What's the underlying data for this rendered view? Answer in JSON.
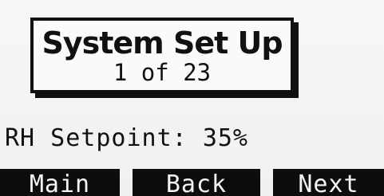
{
  "title": {
    "heading": "System Set Up",
    "page_indicator": "1 of 23"
  },
  "parameter": {
    "label": "RH Setpoint:",
    "value": "35%"
  },
  "softkeys": {
    "main": "Main",
    "back": "Back",
    "next": "Next"
  }
}
